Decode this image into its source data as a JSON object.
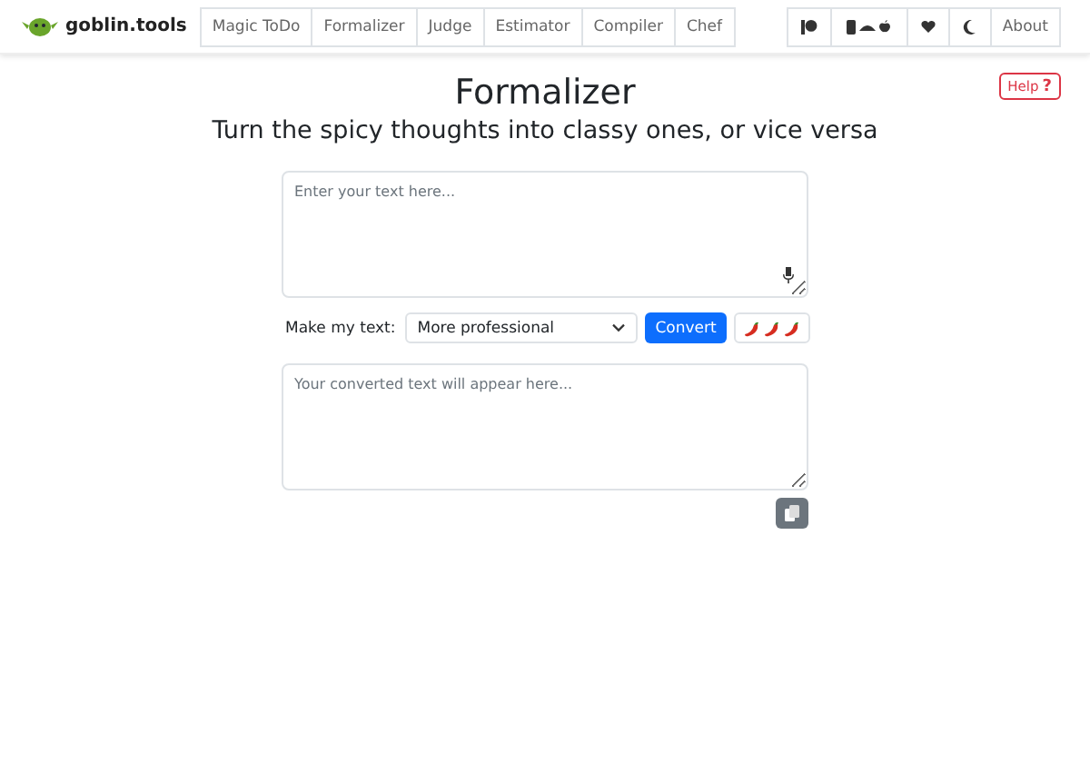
{
  "header": {
    "brand": "goblin.tools",
    "nav": [
      "Magic ToDo",
      "Formalizer",
      "Judge",
      "Estimator",
      "Compiler",
      "Chef"
    ],
    "about": "About"
  },
  "help": {
    "label": "Help",
    "mark": "?"
  },
  "title": "Formalizer",
  "subtitle": "Turn the spicy thoughts into classy ones, or vice versa",
  "input": {
    "placeholder": "Enter your text here..."
  },
  "controls": {
    "label": "Make my text:",
    "select": "More professional",
    "button": "Convert"
  },
  "output": {
    "placeholder": "Your converted text will appear here..."
  }
}
